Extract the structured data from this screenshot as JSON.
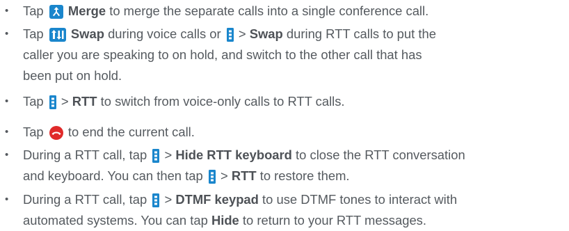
{
  "colors": {
    "text": "#555a5f",
    "bold_text": "#4e5257",
    "icon_blue": "#1a86cc",
    "end_call_red": "#e02a2a"
  },
  "icons": {
    "merge": "merge-call-icon",
    "swap": "swap-call-icon",
    "menu": "menu-more-icon",
    "end_call": "end-call-icon"
  },
  "items": [
    {
      "tap": "Tap",
      "merge": "Merge",
      "rest": "to merge the separate calls into a single conference call."
    },
    {
      "tap": "Tap",
      "swap": "Swap",
      "during_voice_or": "during voice calls or",
      "gt": ">",
      "swap2": "Swap",
      "line1_end": "during RTT calls to put the",
      "line2": "caller you are speaking to on hold, and switch to the other call that has",
      "line3": "been put on hold."
    },
    {
      "tap": "Tap",
      "gt": ">",
      "rtt": "RTT",
      "rest": "to switch from voice-only calls to RTT calls."
    },
    {
      "tap": "Tap",
      "rest": "to end the current call."
    },
    {
      "lead": "During a RTT call, tap",
      "gt": ">",
      "hide_kb": "Hide RTT keyboard",
      "line1_end": "to close the RTT conversation",
      "line2_start": "and keyboard. You can then tap",
      "gt2": ">",
      "rtt": "RTT",
      "line2_end": "to restore them."
    },
    {
      "lead": "During a RTT call, tap",
      "gt": ">",
      "dtmf": "DTMF keypad",
      "line1_end": "to use DTMF tones to interact with",
      "line2_start": "automated systems. You can tap",
      "hide": "Hide",
      "line2_end": "to return to your RTT messages."
    }
  ]
}
